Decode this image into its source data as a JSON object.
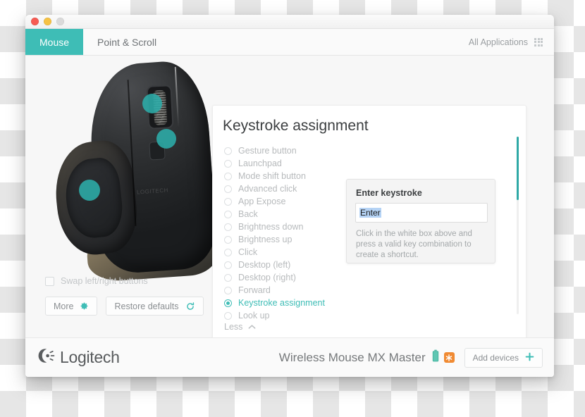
{
  "window": {
    "traffic_lights": [
      "close",
      "minimize",
      "zoom"
    ]
  },
  "tabs": [
    {
      "label": "Mouse",
      "active": true
    },
    {
      "label": "Point & Scroll",
      "active": false
    }
  ],
  "header": {
    "all_applications_label": "All Applications",
    "grid_icon": "grid-icon"
  },
  "mouse_panel": {
    "swap_label": "Swap left/right buttons",
    "swap_checked": false,
    "more_label": "More",
    "more_icon": "gear-icon",
    "restore_label": "Restore defaults",
    "restore_icon": "refresh-icon",
    "hotspots": 3
  },
  "card": {
    "title": "Keystroke assignment",
    "less_label": "Less",
    "less_icon": "chevron-up-icon",
    "options": [
      {
        "label": "Gesture button",
        "selected": false
      },
      {
        "label": "Launchpad",
        "selected": false
      },
      {
        "label": "Mode shift button",
        "selected": false
      },
      {
        "label": "Advanced click",
        "selected": false
      },
      {
        "label": "App Expose",
        "selected": false
      },
      {
        "label": "Back",
        "selected": false
      },
      {
        "label": "Brightness down",
        "selected": false
      },
      {
        "label": "Brightness up",
        "selected": false
      },
      {
        "label": "Click",
        "selected": false
      },
      {
        "label": "Desktop (left)",
        "selected": false
      },
      {
        "label": "Desktop (right)",
        "selected": false
      },
      {
        "label": "Forward",
        "selected": false
      },
      {
        "label": "Keystroke assignment",
        "selected": true
      },
      {
        "label": "Look up",
        "selected": false
      }
    ]
  },
  "popover": {
    "title": "Enter keystroke",
    "input_value": "Enter",
    "hint": "Click in the white box above and press a valid key combination to create a shortcut."
  },
  "footer": {
    "brand": "Logitech",
    "device_name": "Wireless Mouse MX Master",
    "battery_icon": "battery-icon",
    "flow_icon": "flow-icon",
    "add_devices_label": "Add devices",
    "add_icon": "plus-icon"
  },
  "colors": {
    "accent_teal": "#3ebdb6",
    "accent_teal_dark": "#2fa9a6",
    "flow_orange": "#f08a32",
    "battery_green": "#4cb8a4",
    "selection_blue": "#b5d3f5"
  }
}
